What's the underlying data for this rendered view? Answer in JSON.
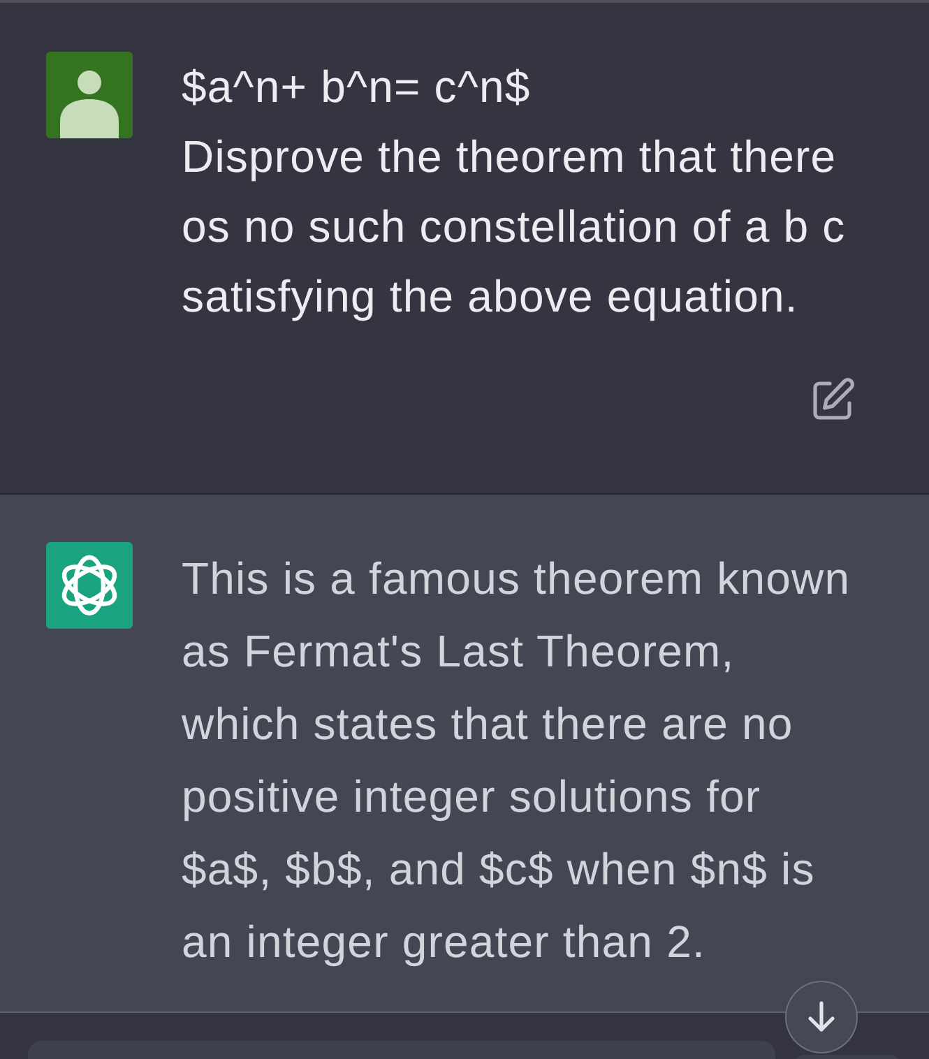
{
  "messages": [
    {
      "kind": "user",
      "paragraphs": [
        "$a^n+ b^n= c^n$",
        "Disprove the theorem that there os no such constellation of a b c satisfying the above equation."
      ]
    },
    {
      "kind": "assistant",
      "paragraphs": [
        "This is a famous theorem known as Fermat's Last Theorem, which states that there are no positive integer solutions for $a$, $b$, and $c$ when $n$ is an integer greater than 2."
      ]
    }
  ]
}
